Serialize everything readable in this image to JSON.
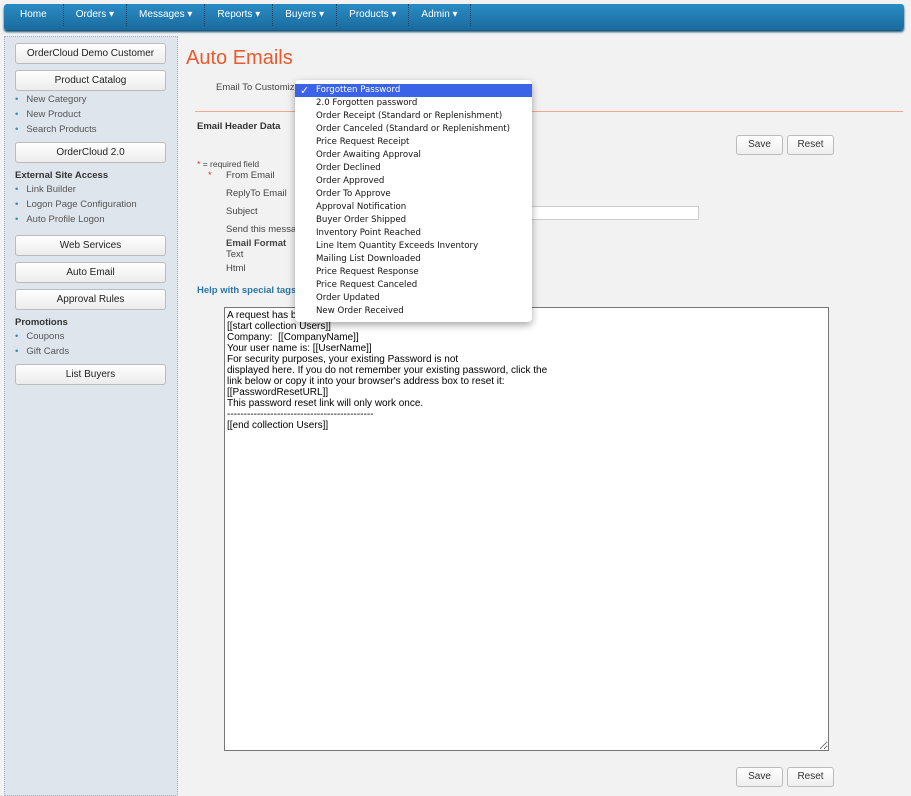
{
  "nav": [
    "Home",
    "Orders ▾",
    "Messages ▾",
    "Reports ▾",
    "Buyers ▾",
    "Products ▾",
    "Admin ▾"
  ],
  "sidebar": {
    "btn_demo": "OrderCloud Demo Customer",
    "btn_catalog": "Product Catalog",
    "catalog_links": [
      "New Category",
      "New Product",
      "Search Products"
    ],
    "btn_oc2": "OrderCloud 2.0",
    "external_head": "External Site Access",
    "external_links": [
      "Link Builder",
      "Logon Page Configuration",
      "Auto Profile Logon"
    ],
    "btn_web": "Web Services",
    "btn_auto": "Auto Email",
    "btn_approval": "Approval Rules",
    "promo_head": "Promotions",
    "promo_links": [
      "Coupons",
      "Gift Cards"
    ],
    "btn_list": "List Buyers"
  },
  "main": {
    "title": "Auto Emails",
    "email_to_customize": "Email To Customiz",
    "header_data": "Email Header Data",
    "required_star": "*",
    "required_note": "= required field",
    "from_email": "From Email",
    "reply_to": "ReplyTo Email",
    "subject": "Subject",
    "send_msg": "Send this messa",
    "email_format": "Email Format",
    "text": "Text",
    "html": "Html",
    "help": "Help with special tags",
    "save": "Save",
    "reset": "Reset",
    "body": "A request has b\n[[start collection Users]]\nCompany:  [[CompanyName]]\nYour user name is: [[UserName]]\nFor security purposes, your existing Password is not\ndisplayed here. If you do not remember your existing password, click the\nlink below or copy it into your browser's address box to reset it:\n[[PasswordResetURL]]\nThis password reset link will only work once.\n--------------------------------------------\n[[end collection Users]]"
  },
  "dropdown": {
    "check": "✓",
    "options": [
      "Forgotten Password",
      "2.0 Forgotten password",
      "Order Receipt (Standard or Replenishment)",
      "Order Canceled (Standard or Replenishment)",
      "Price Request Receipt",
      "Order Awaiting Approval",
      "Order Declined",
      "Order Approved",
      "Order To Approve",
      "Approval Notification",
      "Buyer Order Shipped",
      "Inventory Point Reached",
      "Line Item Quantity Exceeds Inventory",
      "Mailing List Downloaded",
      "Price Request Response",
      "Price Request Canceled",
      "Order Updated",
      "New Order Received"
    ]
  }
}
